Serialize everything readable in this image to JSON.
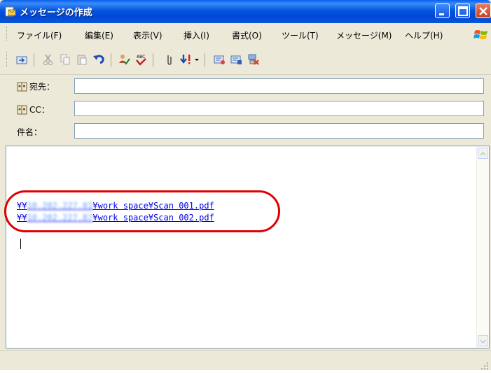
{
  "window": {
    "title": "メッセージの作成"
  },
  "menu": {
    "items": [
      "ファイル(F)",
      "編集(E)",
      "表示(V)",
      "挿入(I)",
      "書式(O)",
      "ツール(T)",
      "メッセージ(M)",
      "ヘルプ(H)"
    ]
  },
  "toolbar": {
    "icons": [
      "send-icon",
      "cut-icon",
      "copy-icon",
      "paste-icon",
      "undo-icon",
      "check-names-icon",
      "spelling-icon",
      "attach-icon",
      "priority-icon",
      "sign-icon",
      "encrypt-icon",
      "offline-icon"
    ]
  },
  "header": {
    "to_label": "宛先：",
    "cc_label": "CC：",
    "subject_label": "件名："
  },
  "body": {
    "link1_prefix": "¥¥",
    "link1_host": "10.202.227.81",
    "link1_suffix": "¥work space¥Scan 001.pdf",
    "link2_prefix": "¥¥",
    "link2_host": "10.202.227.87",
    "link2_suffix": "¥work space¥Scan 002.pdf"
  },
  "colors": {
    "highlight": "#e00000",
    "link": "#0000ee",
    "titlebar": "#0047d6"
  }
}
